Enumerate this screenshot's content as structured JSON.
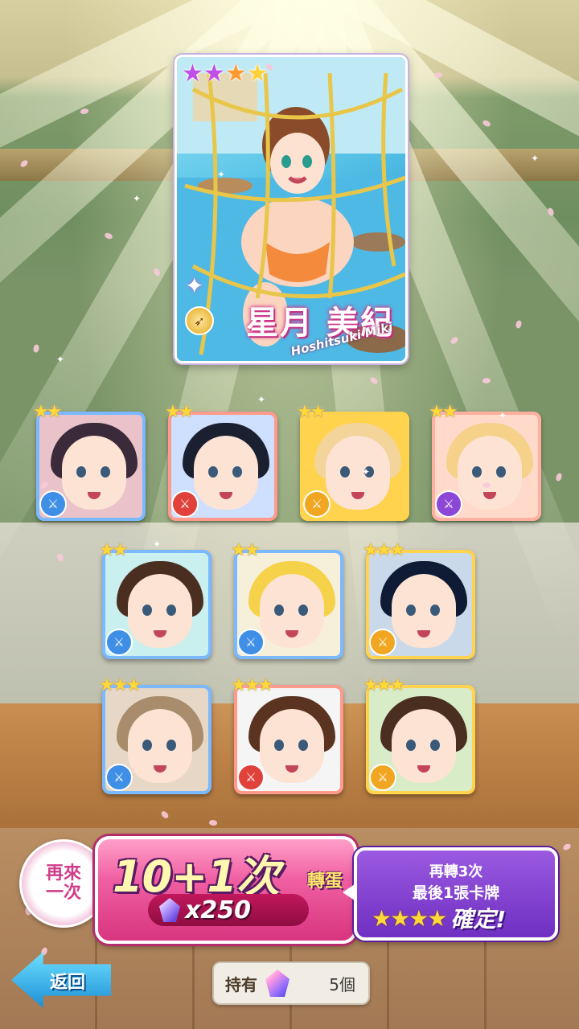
{
  "featured_card": {
    "rarity_stars": [
      "★",
      "★",
      "★",
      "★"
    ],
    "name": "星月 美紀",
    "romanized": "Hoshitsuki Miki",
    "attribute_icon": "gun-icon"
  },
  "result_cards": [
    {
      "stars": "★★",
      "attribute": "blue",
      "theme": [
        "#e9c3c9",
        "#3a2a3a"
      ]
    },
    {
      "stars": "★★",
      "attribute": "red",
      "theme": [
        "#cfe0ff",
        "#1a2030"
      ]
    },
    {
      "stars": "★★",
      "attribute": "yellow",
      "theme": [
        "#ffd34d",
        "#f3d49a"
      ]
    },
    {
      "stars": "★★",
      "attribute": "purple",
      "theme": [
        "#ffd9c9",
        "#f6d18a"
      ]
    },
    {
      "stars": "★★",
      "attribute": "blue",
      "theme": [
        "#c9f0ef",
        "#4a2e20"
      ]
    },
    {
      "stars": "★★",
      "attribute": "blue",
      "theme": [
        "#f6efd9",
        "#f6d24a"
      ]
    },
    {
      "stars": "★★★",
      "attribute": "yellow",
      "theme": [
        "#c9d9e9",
        "#0f1a35"
      ]
    },
    {
      "stars": "★★★",
      "attribute": "blue",
      "theme": [
        "#e6d7c6",
        "#a98c6c"
      ]
    },
    {
      "stars": "★★★",
      "attribute": "red",
      "theme": [
        "#f5f5f5",
        "#5a3420"
      ]
    },
    {
      "stars": "★★★",
      "attribute": "yellow",
      "theme": [
        "#d8ecc8",
        "#4a2e20"
      ]
    }
  ],
  "actions": {
    "again_badge": [
      "再來",
      "一次"
    ],
    "spin_title": "10+1次",
    "spin_suffix": "轉蛋",
    "cost": "x250",
    "guarantee_line1": "再轉3次",
    "guarantee_line2": "最後1張卡牌",
    "guarantee_stars": "★★★★",
    "guarantee_confirm": "確定!",
    "back_label": "返回",
    "hold_label": "持有",
    "hold_count": "5個"
  },
  "colors": {
    "attr_blue": "#3f8fe6",
    "attr_red": "#e0413b",
    "attr_yellow": "#f0a620",
    "attr_purple": "#8c47d6"
  }
}
